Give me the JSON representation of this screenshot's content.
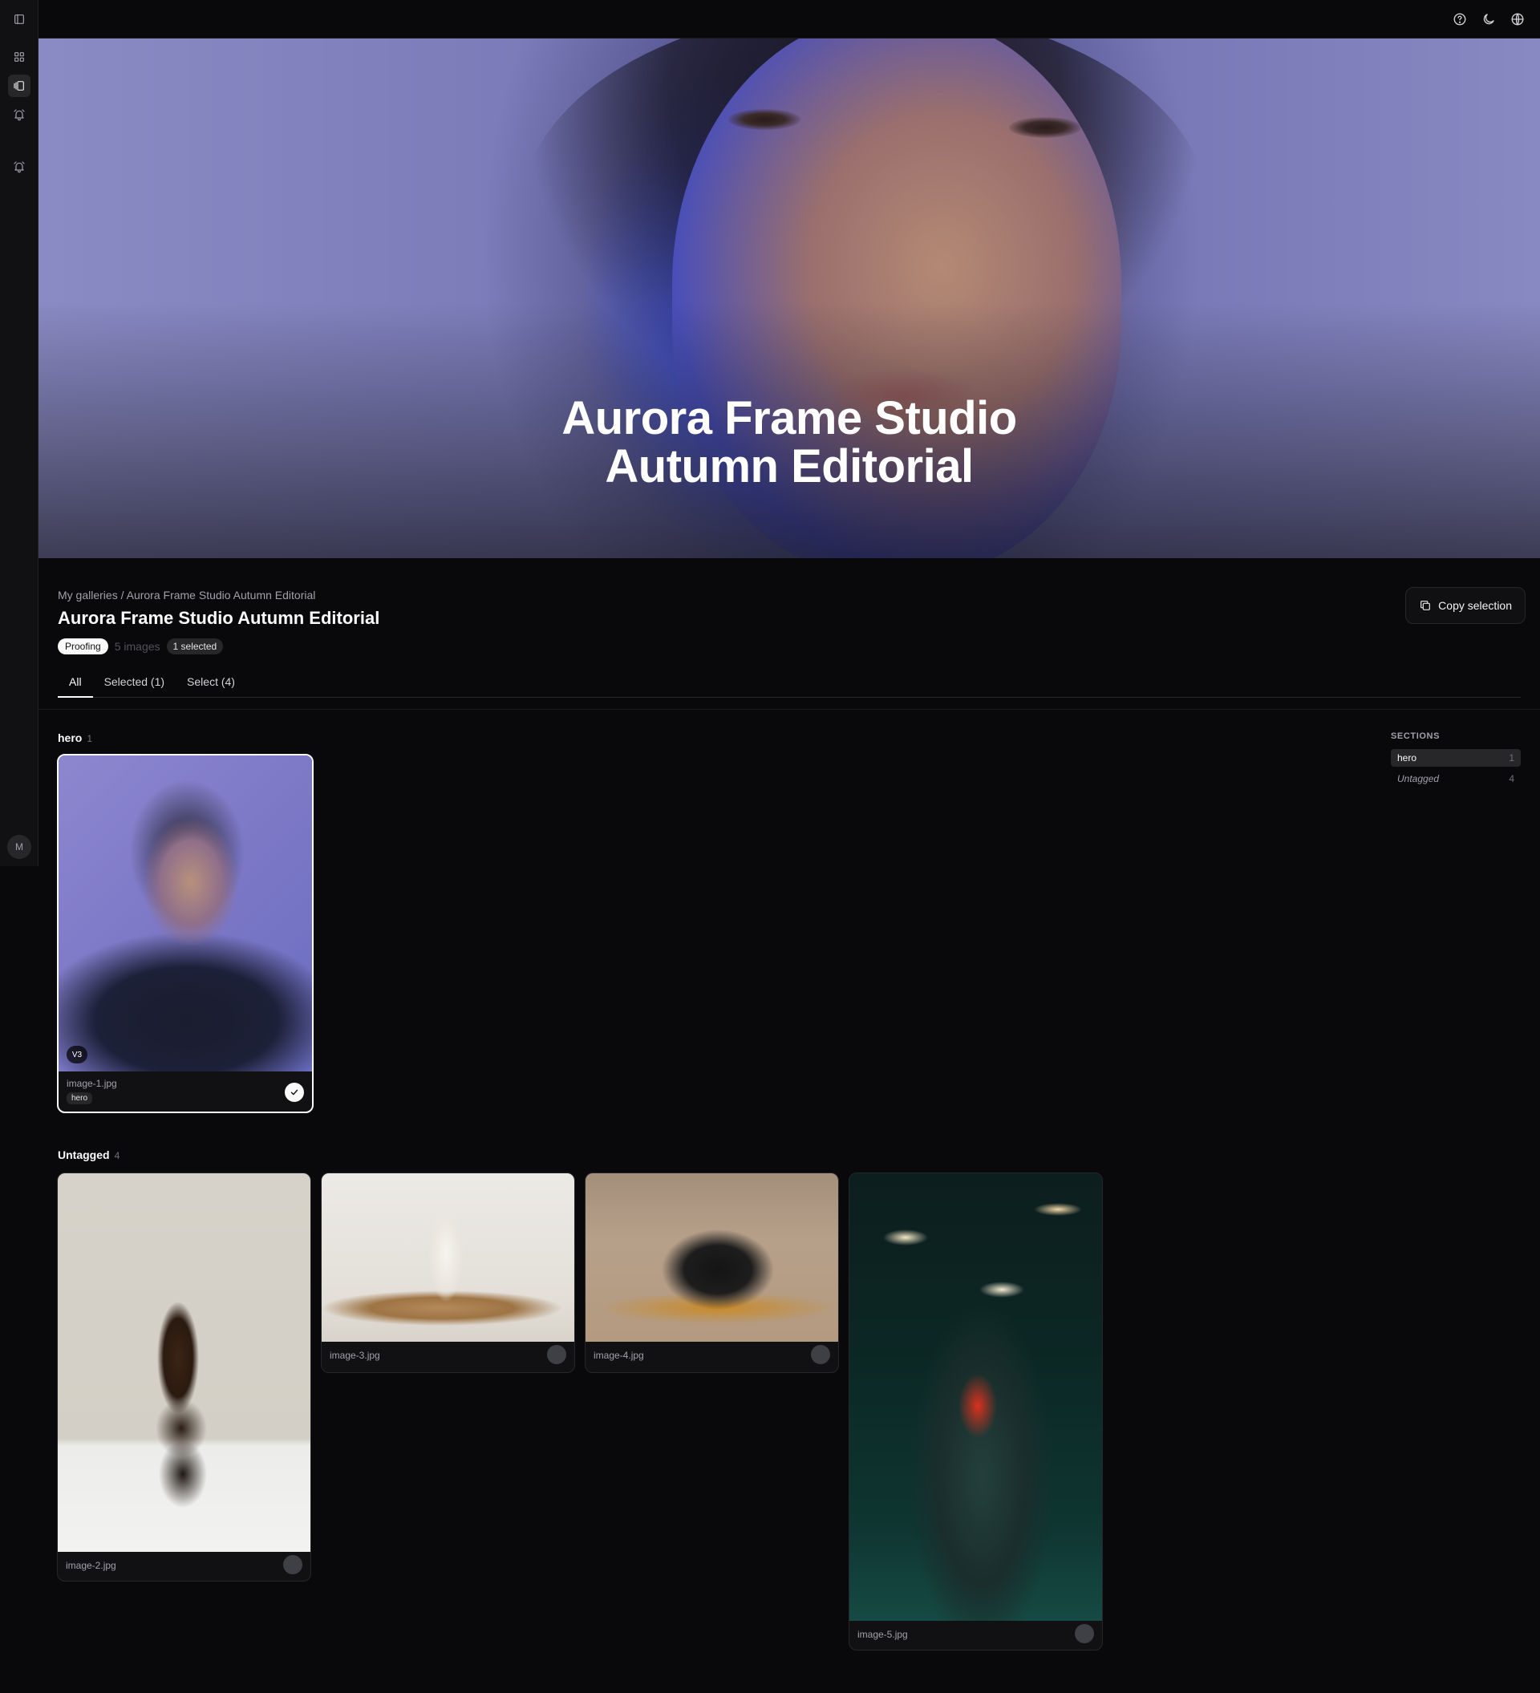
{
  "hero": {
    "title_line1": "Aurora Frame Studio",
    "title_line2": "Autumn Editorial"
  },
  "breadcrumb": {
    "root": "My galleries",
    "separator": "/",
    "current": "Aurora Frame Studio Autumn Editorial"
  },
  "page": {
    "title": "Aurora Frame Studio Autumn Editorial",
    "status": "Proofing",
    "image_count": "5 images",
    "selected_count": "1 selected"
  },
  "actions": {
    "copy_selection": "Copy selection"
  },
  "tabs": [
    {
      "label": "All"
    },
    {
      "label": "Selected (1)"
    },
    {
      "label": "Select (4)"
    }
  ],
  "sections": {
    "hero": {
      "label": "hero",
      "count": "1"
    },
    "untagged": {
      "label": "Untagged",
      "count": "4"
    }
  },
  "images": [
    {
      "file": "image-1.jpg",
      "tag": "hero",
      "version": "V3",
      "selected": true
    },
    {
      "file": "image-2.jpg",
      "selected": false
    },
    {
      "file": "image-3.jpg",
      "selected": false
    },
    {
      "file": "image-4.jpg",
      "selected": false
    },
    {
      "file": "image-5.jpg",
      "selected": false
    }
  ],
  "sections_panel": {
    "title": "SECTIONS",
    "items": [
      {
        "label": "hero",
        "count": "1"
      },
      {
        "label": "Untagged",
        "count": "4"
      }
    ]
  },
  "user": {
    "avatar_initial": "M"
  },
  "colors": {
    "background": "#09090b",
    "sidebar": "#111113",
    "accent": "#fafafa"
  }
}
